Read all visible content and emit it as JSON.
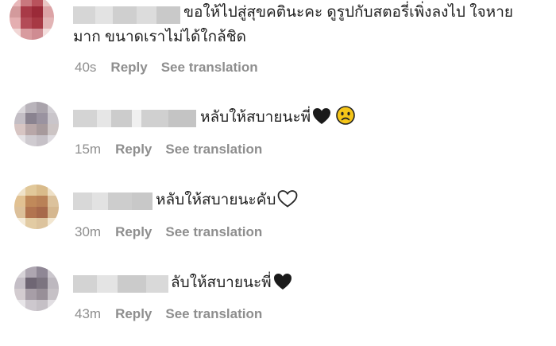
{
  "comments": [
    {
      "text_line1": "ขอให้ไปสู่สุขคตินะคะ ดูรูปกับสตอรี่เพิ่งลงไป ใจหาย",
      "text_line2": "มาก ขนาดเราไม่ได้ใกล้ชิด",
      "time": "40s",
      "reply_label": "Reply",
      "translate_label": "See translation",
      "avatar_colors": [
        "#e8b7b9",
        "#c9787e",
        "#b9525c",
        "#e9c7c5",
        "#d39a9c",
        "#a83a47",
        "#9b2a38",
        "#dca3a6",
        "#e4aeb0",
        "#b34b57",
        "#a73944",
        "#e2b4b5",
        "#f1d6d5",
        "#d89b9f",
        "#cf8c92",
        "#f3dedd"
      ]
    },
    {
      "text": "หลับให้สบายนะพี่",
      "emojis": [
        "black-heart-icon",
        "sad-face-icon"
      ],
      "time": "15m",
      "reply_label": "Reply",
      "translate_label": "See translation",
      "avatar_colors": [
        "#d9d6da",
        "#b9b4bb",
        "#a9a3ab",
        "#d1ced3",
        "#c3bec5",
        "#8a8390",
        "#9a93a0",
        "#c9c5ca",
        "#d7c5c3",
        "#b8a7a8",
        "#a79a9c",
        "#ccc4c4",
        "#e4e1e4",
        "#cfcbd0",
        "#c6c1c7",
        "#dedbe0"
      ]
    },
    {
      "text": "หลับให้สบายนะคับ",
      "emojis": [
        "white-heart-icon"
      ],
      "time": "30m",
      "reply_label": "Reply",
      "translate_label": "See translation",
      "avatar_colors": [
        "#efe2c9",
        "#e1c89a",
        "#d9bb8b",
        "#eee0c6",
        "#e1c192",
        "#c0895a",
        "#b98157",
        "#dcc29c",
        "#dcc09a",
        "#b27450",
        "#a7694b",
        "#d5b78f",
        "#f4ead7",
        "#e2cba3",
        "#dcc39d",
        "#f2e6d0"
      ]
    },
    {
      "text": "ลับให้สบายนะพี่",
      "emojis": [
        "black-heart-icon"
      ],
      "time": "43m",
      "reply_label": "Reply",
      "translate_label": "See translation",
      "avatar_colors": [
        "#d7d3d8",
        "#aea6b1",
        "#8f8795",
        "#cbc7cd",
        "#c4bec6",
        "#6f6674",
        "#7c7480",
        "#bdb8bf",
        "#d3ccd0",
        "#a79ea7",
        "#988f98",
        "#c6c1c6",
        "#e7e5e8",
        "#cdc8ce",
        "#c5c0c6",
        "#e1dee2"
      ]
    }
  ]
}
